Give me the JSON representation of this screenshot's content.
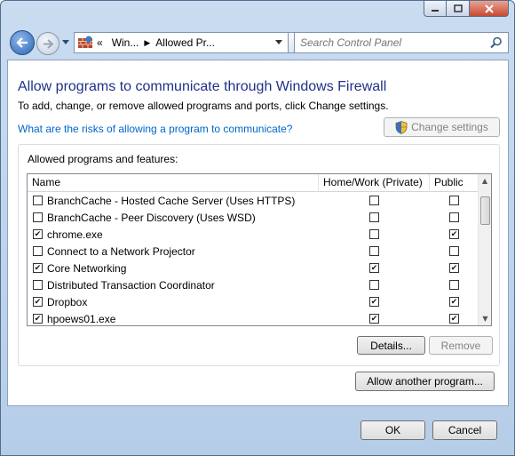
{
  "nav": {
    "breadcrumb_overflow": "«",
    "crumbs": [
      "Win...",
      "Allowed Pr..."
    ],
    "search_placeholder": "Search Control Panel"
  },
  "main": {
    "heading": "Allow programs to communicate through Windows Firewall",
    "subtext": "To add, change, or remove allowed programs and ports, click Change settings.",
    "risk_link": "What are the risks of allowing a program to communicate?",
    "change_settings": "Change settings",
    "group_label": "Allowed programs and features:",
    "columns": {
      "name": "Name",
      "home": "Home/Work (Private)",
      "public": "Public"
    },
    "rows": [
      {
        "name": "BranchCache - Hosted Cache Server (Uses HTTPS)",
        "enabled": false,
        "home": false,
        "public": false
      },
      {
        "name": "BranchCache - Peer Discovery (Uses WSD)",
        "enabled": false,
        "home": false,
        "public": false
      },
      {
        "name": "chrome.exe",
        "enabled": true,
        "home": false,
        "public": true
      },
      {
        "name": "Connect to a Network Projector",
        "enabled": false,
        "home": false,
        "public": false
      },
      {
        "name": "Core Networking",
        "enabled": true,
        "home": true,
        "public": true
      },
      {
        "name": "Distributed Transaction Coordinator",
        "enabled": false,
        "home": false,
        "public": false
      },
      {
        "name": "Dropbox",
        "enabled": true,
        "home": true,
        "public": true
      },
      {
        "name": "hpoews01.exe",
        "enabled": true,
        "home": true,
        "public": true
      }
    ],
    "details": "Details...",
    "remove": "Remove",
    "allow_another": "Allow another program..."
  },
  "footer": {
    "ok": "OK",
    "cancel": "Cancel"
  },
  "colors": {
    "heading": "#1e3287",
    "link": "#0066cc",
    "chrome": "#c9dcf0"
  }
}
